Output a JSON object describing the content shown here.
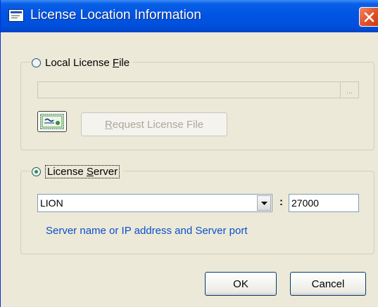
{
  "window": {
    "title": "License Location Information"
  },
  "local_license": {
    "label_pre": "Local License ",
    "label_key": "F",
    "label_post": "ile",
    "selected": false,
    "file_path": "",
    "browse_label": "...",
    "request_pre": "",
    "request_key": "R",
    "request_post": "equest License File"
  },
  "license_server": {
    "label_pre": "License ",
    "label_key": "S",
    "label_post": "erver",
    "selected": true,
    "server_name": "LION",
    "colon": ":",
    "port": "27000",
    "hint": "Server name or IP address and Server port"
  },
  "buttons": {
    "ok": "OK",
    "cancel": "Cancel"
  },
  "colors": {
    "title_bar": "#0054e3",
    "hint_text": "#0a4fcc",
    "dialog_bg": "#ece9d8"
  },
  "icons": [
    "dialog-app-icon",
    "close-icon",
    "certificate-icon",
    "chevron-down-icon"
  ]
}
